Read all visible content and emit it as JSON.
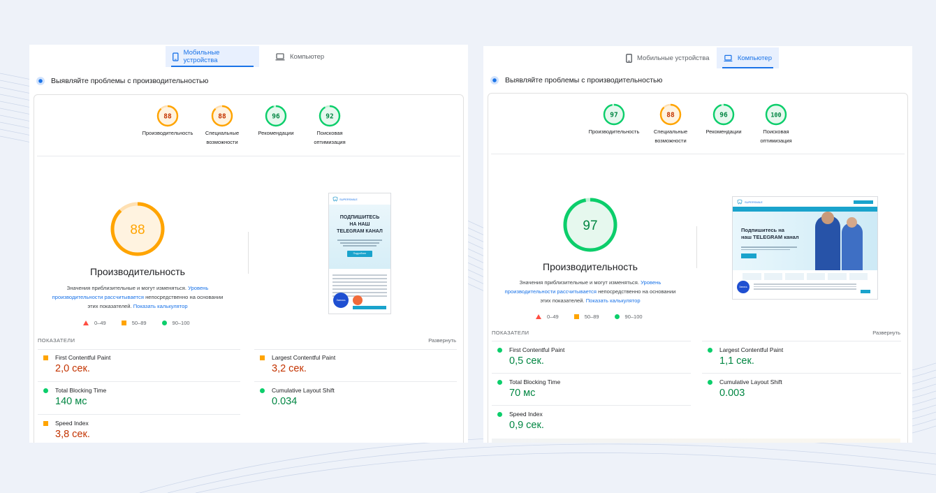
{
  "mobile_panel": {
    "tabs": [
      {
        "label": "Мобильные устройства",
        "active": true
      },
      {
        "label": "Компьютер",
        "active": false
      }
    ],
    "section_title": "Выявляйте проблемы с производительностью",
    "scores": [
      {
        "value": "88",
        "label_lines": [
          "Производительность"
        ],
        "color": "#ffa400"
      },
      {
        "value": "88",
        "label_lines": [
          "Специальные",
          "возможности"
        ],
        "color": "#ffa400"
      },
      {
        "value": "96",
        "label_lines": [
          "Рекомендации"
        ],
        "color": "#0cce6b"
      },
      {
        "value": "92",
        "label_lines": [
          "Поисковая",
          "оптимизация"
        ],
        "color": "#0cce6b"
      }
    ],
    "main_score": {
      "value": "88",
      "label": "Производительность",
      "color": "#ffa400"
    },
    "description": {
      "part1": "Значения приблизительные и могут изменяться. ",
      "link1": "Уровень производительности рассчитывается",
      "part2": " непосредственно на основании этих показателей. ",
      "link2": "Показать калькулятор"
    },
    "legend": [
      "0–49",
      "50–89",
      "90–100"
    ],
    "metrics_header": "ПОКАЗАТЕЛИ",
    "expand_label": "Развернуть",
    "metrics": [
      {
        "name": "First Contentful Paint",
        "value": "2,0 сек.",
        "status": "orange"
      },
      {
        "name": "Largest Contentful Paint",
        "value": "3,2 сек.",
        "status": "orange"
      },
      {
        "name": "Total Blocking Time",
        "value": "140 мс",
        "status": "green"
      },
      {
        "name": "Cumulative Layout Shift",
        "value": "0.034",
        "status": "green"
      },
      {
        "name": "Speed Index",
        "value": "3,8 сек.",
        "status": "orange"
      }
    ],
    "thumbnail": {
      "logo": "SUPERSMILE",
      "headline_lines": [
        "ПОДПИШИТЕСЬ",
        "НА НАШ",
        "TELEGRAM КАНАЛ"
      ],
      "button": "Подробнее",
      "fab_label": "Запись"
    }
  },
  "desktop_panel": {
    "tabs": [
      {
        "label": "Мобильные устройства",
        "active": false
      },
      {
        "label": "Компьютер",
        "active": true
      }
    ],
    "section_title": "Выявляйте проблемы с производительностью",
    "scores": [
      {
        "value": "97",
        "label_lines": [
          "Производительность"
        ],
        "color": "#0cce6b"
      },
      {
        "value": "88",
        "label_lines": [
          "Специальные",
          "возможности"
        ],
        "color": "#ffa400"
      },
      {
        "value": "96",
        "label_lines": [
          "Рекомендации"
        ],
        "color": "#0cce6b"
      },
      {
        "value": "100",
        "label_lines": [
          "Поисковая",
          "оптимизация"
        ],
        "color": "#0cce6b"
      }
    ],
    "main_score": {
      "value": "97",
      "label": "Производительность",
      "color": "#0cce6b"
    },
    "description": {
      "part1": "Значения приблизительные и могут изменяться. ",
      "link1": "Уровень производительности рассчитывается",
      "part2": " непосредственно на основании этих показателей. ",
      "link2": "Показать калькулятор"
    },
    "legend": [
      "0–49",
      "50–89",
      "90–100"
    ],
    "metrics_header": "ПОКАЗАТЕЛИ",
    "expand_label": "Развернуть",
    "metrics": [
      {
        "name": "First Contentful Paint",
        "value": "0,5 сек.",
        "status": "green"
      },
      {
        "name": "Largest Contentful Paint",
        "value": "1,1 сек.",
        "status": "green"
      },
      {
        "name": "Total Blocking Time",
        "value": "70 мс",
        "status": "green"
      },
      {
        "name": "Cumulative Layout Shift",
        "value": "0.003",
        "status": "green"
      },
      {
        "name": "Speed Index",
        "value": "0,9 сек.",
        "status": "green"
      }
    ],
    "thumbnail": {
      "logo": "SUPERSMILE",
      "headline_lines": [
        "Подпишитесь на",
        "наш TELEGRAM канал"
      ],
      "fab_label": "Запись"
    }
  }
}
